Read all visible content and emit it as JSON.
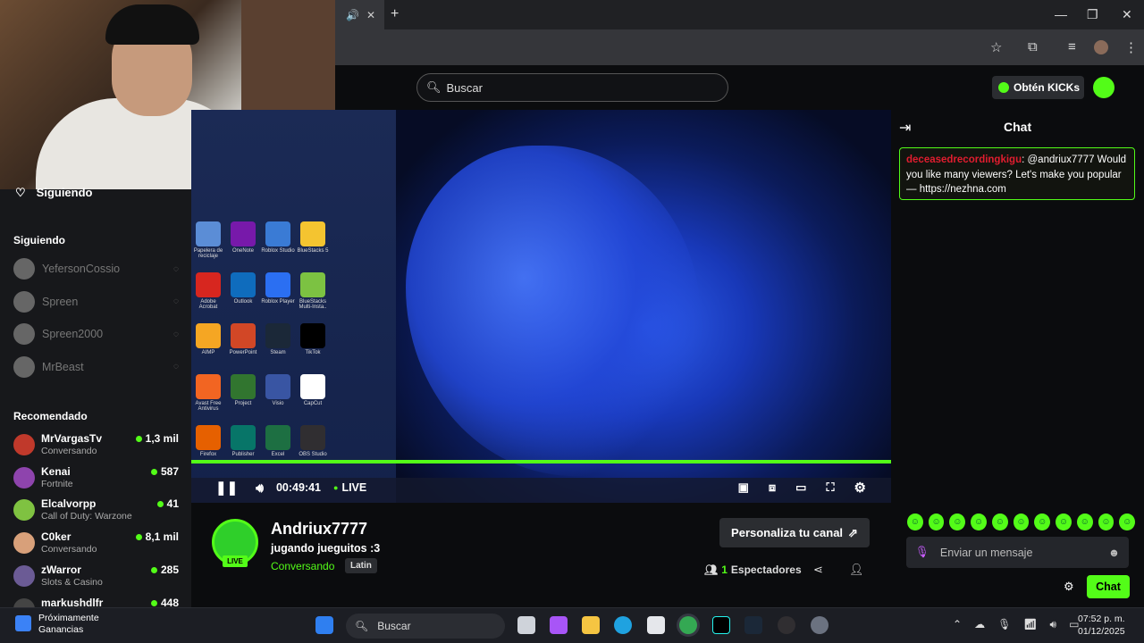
{
  "browser": {
    "tab_close": "✕",
    "new_tab": "+",
    "window_controls": [
      "—",
      "❐",
      "✕"
    ]
  },
  "header": {
    "search_placeholder": "Buscar",
    "kicks_label": "Obtén KICKs"
  },
  "sidebar": {
    "following_top": "Siguiendo",
    "following_header": "Siguiendo",
    "following": [
      {
        "name": "YefersonCossio"
      },
      {
        "name": "Spreen"
      },
      {
        "name": "Spreen2000"
      },
      {
        "name": "MrBeast"
      }
    ],
    "recommended_header": "Recomendado",
    "recommended": [
      {
        "name": "MrVargasTv",
        "category": "Conversando",
        "viewers": "1,3 mil",
        "color": "#c0392b"
      },
      {
        "name": "Kenai",
        "category": "Fortnite",
        "viewers": "587",
        "color": "#8e44ad"
      },
      {
        "name": "Elcalvorpp",
        "category": "Call of Duty: Warzone",
        "viewers": "41",
        "color": "#7fc241"
      },
      {
        "name": "C0ker",
        "category": "Conversando",
        "viewers": "8,1 mil",
        "color": "#d8a07a"
      },
      {
        "name": "zWarror",
        "category": "Slots & Casino",
        "viewers": "285",
        "color": "#6b5b95"
      },
      {
        "name": "markushdlfr",
        "category": "",
        "viewers": "448",
        "color": "#444"
      }
    ]
  },
  "player": {
    "desktop_icons": [
      {
        "label": "Papelera de reciclaje",
        "color": "#5b8dd6"
      },
      {
        "label": "OneNote",
        "color": "#7719aa"
      },
      {
        "label": "Roblox Studio",
        "color": "#3a7bd5"
      },
      {
        "label": "BlueStacks 5",
        "color": "#f4c430"
      },
      {
        "label": "Adobe Acrobat",
        "color": "#d7261f"
      },
      {
        "label": "Outlook",
        "color": "#0f6cbd"
      },
      {
        "label": "Roblox Player",
        "color": "#2b6ff2"
      },
      {
        "label": "BlueStacks Multi-Insta..",
        "color": "#7cc242"
      },
      {
        "label": "AIMP",
        "color": "#f5a623"
      },
      {
        "label": "PowerPoint",
        "color": "#d24726"
      },
      {
        "label": "Steam",
        "color": "#1b2838"
      },
      {
        "label": "TikTok",
        "color": "#000000"
      },
      {
        "label": "Avast Free Antivirus",
        "color": "#f26522"
      },
      {
        "label": "Project",
        "color": "#31752f"
      },
      {
        "label": "Visio",
        "color": "#3955a3"
      },
      {
        "label": "CapCut",
        "color": "#ffffff"
      },
      {
        "label": "Firefox",
        "color": "#e66000"
      },
      {
        "label": "Publisher",
        "color": "#077568"
      },
      {
        "label": "Excel",
        "color": "#1d6f42"
      },
      {
        "label": "OBS Studio",
        "color": "#302e31"
      }
    ],
    "time": "00:49:41",
    "live_label": "LIVE",
    "progress": 1.0
  },
  "stream": {
    "streamer": "Andriux7777",
    "title": "jugando jueguitos :3",
    "category": "Conversando",
    "language": "Latin",
    "live_badge": "LIVE",
    "customize_label": "Personaliza tu canal",
    "viewer_count": "1",
    "viewer_label": "Espectadores"
  },
  "chat": {
    "title": "Chat",
    "message": {
      "user": "deceasedrecordingkigu",
      "text": ": @andriux7777 Would you like many viewers? Let's make you popular — https://nezhna.com"
    },
    "emote_count": 11,
    "input_placeholder": "Enviar un mensaje",
    "send_label": "Chat"
  },
  "taskbar": {
    "news_title": "Próximamente",
    "news_sub": "Ganancias",
    "search_label": "Buscar",
    "time": "07:52 p. m.",
    "date": "01/12/2025"
  },
  "colors": {
    "accent": "#53fc18",
    "chat_user": "#e11d2f"
  }
}
